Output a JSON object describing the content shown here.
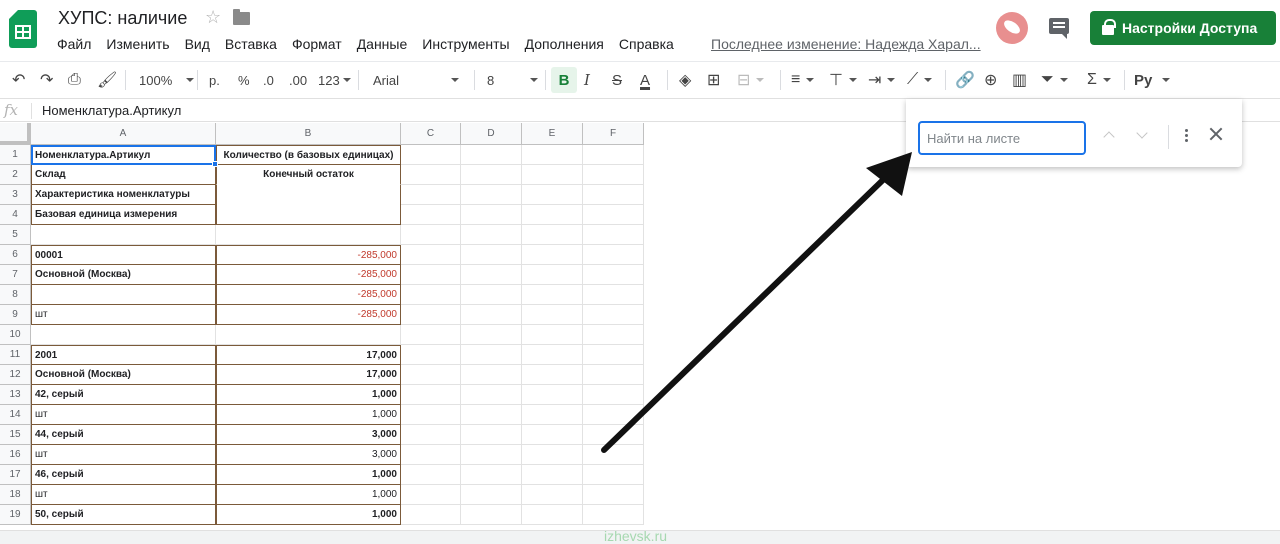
{
  "header": {
    "title": "ХУПС: наличие",
    "menu": [
      "Файл",
      "Изменить",
      "Вид",
      "Вставка",
      "Формат",
      "Данные",
      "Инструменты",
      "Дополнения",
      "Справка"
    ],
    "last_edit": "Последнее изменение: Надежда Харал...",
    "share_label": "Настройки Доступа"
  },
  "toolbar": {
    "zoom": "100%",
    "currency": "р.",
    "percent": "%",
    "dec_less": ".0",
    "dec_more": ".00",
    "format_num": "123",
    "font": "Arial",
    "font_size": "8",
    "bold": "B",
    "italic": "I",
    "strike": "S",
    "text_color": "A",
    "sum": "Σ",
    "lang": "Ру"
  },
  "formula_bar": {
    "fx": "fx",
    "value": "Номенклатура.Артикул"
  },
  "grid": {
    "columns": [
      "A",
      "B",
      "C",
      "D",
      "E",
      "F"
    ],
    "rows": [
      {
        "n": "1",
        "a": "Номенклатура.Артикул",
        "b": "Количество (в базовых единицах)"
      },
      {
        "n": "2",
        "a": "Склад",
        "b": "Конечный остаток"
      },
      {
        "n": "3",
        "a": "Характеристика номенклатуры",
        "b": ""
      },
      {
        "n": "4",
        "a": "Базовая единица измерения",
        "b": ""
      },
      {
        "n": "5",
        "a": "",
        "b": ""
      },
      {
        "n": "6",
        "a": "00001",
        "b": "-285,000"
      },
      {
        "n": "7",
        "a": "Основной (Москва)",
        "b": "-285,000"
      },
      {
        "n": "8",
        "a": "",
        "b": "-285,000"
      },
      {
        "n": "9",
        "a": "шт",
        "b": "-285,000"
      },
      {
        "n": "10",
        "a": "",
        "b": ""
      },
      {
        "n": "11",
        "a": "2001",
        "b": "17,000"
      },
      {
        "n": "12",
        "a": "Основной (Москва)",
        "b": "17,000"
      },
      {
        "n": "13",
        "a": "42, серый",
        "b": "1,000"
      },
      {
        "n": "14",
        "a": "шт",
        "b": "1,000"
      },
      {
        "n": "15",
        "a": "44, серый",
        "b": "3,000"
      },
      {
        "n": "16",
        "a": "шт",
        "b": "3,000"
      },
      {
        "n": "17",
        "a": "46, серый",
        "b": "1,000"
      },
      {
        "n": "18",
        "a": "шт",
        "b": "1,000"
      },
      {
        "n": "19",
        "a": "50, серый",
        "b": "1,000"
      }
    ]
  },
  "find": {
    "placeholder": "Найти на листе"
  },
  "watermark": "izhevsk.ru",
  "colors": {
    "accent": "#188038",
    "selection": "#1a73e8",
    "negative": "#c0392b"
  }
}
